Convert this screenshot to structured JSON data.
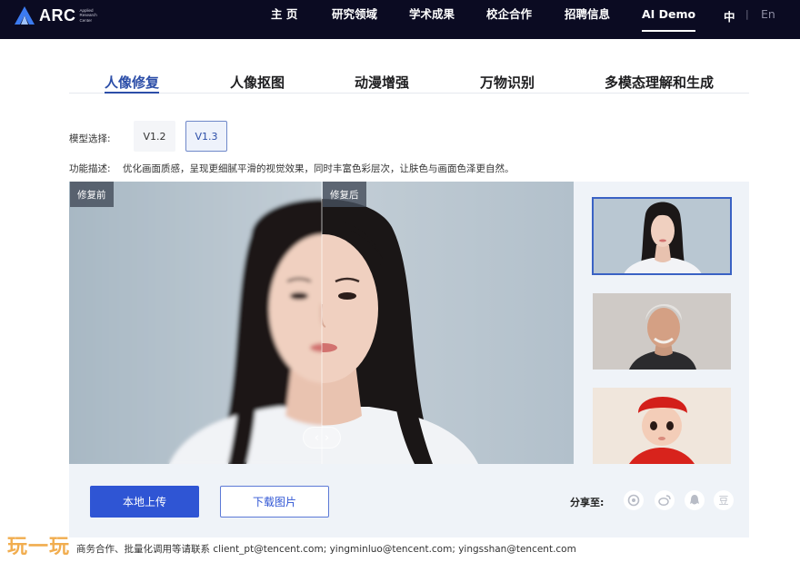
{
  "brand": {
    "name": "ARC",
    "subtitle": "Applied Research Center"
  },
  "nav": {
    "items": [
      "主 页",
      "研究领域",
      "学术成果",
      "校企合作",
      "招聘信息",
      "AI Demo"
    ],
    "active_index": 5,
    "lang_zh": "中",
    "lang_sep": "|",
    "lang_en": "En"
  },
  "tabs": {
    "items": [
      "人像修复",
      "人像抠图",
      "动漫增强",
      "万物识别",
      "多模态理解和生成"
    ],
    "active_index": 0
  },
  "model": {
    "label": "模型选择:",
    "options": [
      "V1.2",
      "V1.3"
    ],
    "selected": "V1.3"
  },
  "feature": {
    "label": "功能描述:",
    "description": "优化画面质感，呈现更细腻平滑的视觉效果，同时丰富色彩层次，让肤色与画面色泽更自然。"
  },
  "viewer": {
    "before_label": "修复前",
    "after_label": "修复后",
    "handle_left": "‹",
    "handle_right": "›"
  },
  "thumbnails": [
    {
      "name": "young-woman",
      "selected": true
    },
    {
      "name": "older-man",
      "selected": false
    },
    {
      "name": "baby-red-hat",
      "selected": false
    }
  ],
  "actions": {
    "upload": "本地上传",
    "download": "下载图片"
  },
  "share": {
    "label": "分享至:",
    "icons": [
      "wechat-moments-icon",
      "weibo-icon",
      "qq-icon",
      "douban-icon"
    ],
    "douban_glyph": "豆"
  },
  "footer": {
    "text": "商务合作、批量化调用等请联系 client_pt@tencent.com; yingminluo@tencent.com; yingsshan@tencent.com"
  },
  "watermark": "玩一玩",
  "colors": {
    "nav_bg": "#0b0b22",
    "accent": "#2f55d4",
    "tab_active": "#2c4ea8",
    "panel_bg": "#eff3f8"
  }
}
